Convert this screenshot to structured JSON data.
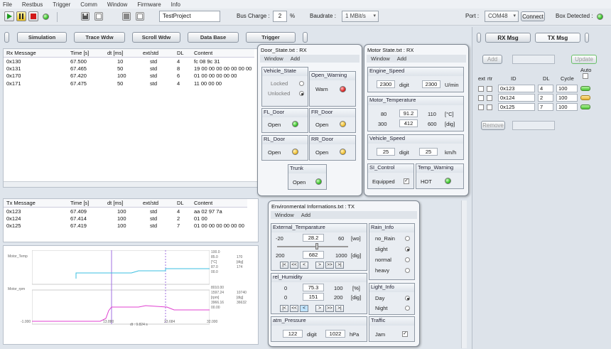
{
  "menu": [
    "File",
    "Restbus",
    "Trigger",
    "Comm",
    "Window",
    "Firmware",
    "Info"
  ],
  "toolbar": {
    "project_name": "TestProject",
    "bus_charge_label": "Bus Charge :",
    "bus_charge_value": "2",
    "bus_charge_unit": "%",
    "baudrate_label": "Baudrate :",
    "baudrate_value": "1 MBit/s",
    "port_label": "Port :",
    "port_value": "COM48",
    "connect_label": "Connect",
    "box_detected_label": "Box Detected :"
  },
  "tabs": [
    "Simulation",
    "Trace Wdw",
    "Scroll Wdw",
    "Data Base",
    "Trigger"
  ],
  "rx_table": {
    "headers": [
      "Rx Message",
      "Time [s]",
      "dt [ms]",
      "ext/std",
      "DL",
      "Content"
    ],
    "rows": [
      [
        "0x130",
        "67.500",
        "10",
        "std",
        "4",
        "fc 08 9c 31"
      ],
      [
        "0x131",
        "67.465",
        "50",
        "std",
        "8",
        "19 00 00 00 00 00 00 00"
      ],
      [
        "0x170",
        "67.420",
        "100",
        "std",
        "6",
        "01 00 00 00 00 00"
      ],
      [
        "0x171",
        "67.475",
        "50",
        "std",
        "4",
        "11 00 00 00"
      ]
    ]
  },
  "tx_table": {
    "headers": [
      "Tx Message",
      "Time [s]",
      "dt [ms]",
      "ext/std",
      "DL",
      "Content"
    ],
    "rows": [
      [
        "0x123",
        "67.409",
        "100",
        "std",
        "4",
        "aa 02 97 7a"
      ],
      [
        "0x124",
        "67.414",
        "100",
        "std",
        "2",
        "01 00"
      ],
      [
        "0x125",
        "67.419",
        "100",
        "std",
        "7",
        "01 00 00 00 00 00 00"
      ]
    ]
  },
  "graph": {
    "label_top": "Motor_Temp",
    "label_bottom": "Motor_rpm",
    "x_start": "-1.000",
    "x_cursor1": "13.880",
    "x_cursor2": "23.684",
    "x_end": "32.000",
    "dt_label": "dt : 9.824 s",
    "right_top": [
      "100.0",
      "85.0",
      "[°C]",
      "87.0",
      "00.0"
    ],
    "right_top2": [
      "170",
      "[dig]",
      "174"
    ],
    "right_bottom": [
      "8010.00",
      "1597.24",
      "[rpm]",
      "3966.16",
      "00.00"
    ],
    "right_bottom2": [
      "10740",
      "[dig]",
      "36632"
    ]
  },
  "door_window": {
    "title": "Door_State.txt : RX",
    "menu": [
      "Window",
      "Add"
    ],
    "vehicle_state": {
      "label": "Vehicle_State",
      "opt1": "Locked",
      "opt2": "Unlocked"
    },
    "open_warning": {
      "label": "Open_Warning",
      "value": "Warn"
    },
    "fl": {
      "label": "FL_Door",
      "value": "Open"
    },
    "fr": {
      "label": "FR_Door",
      "value": "Open"
    },
    "rl": {
      "label": "RL_Door",
      "value": "Open"
    },
    "rr": {
      "label": "RR_Door",
      "value": "Open"
    },
    "trunk": {
      "label": "Trunk",
      "value": "Open"
    }
  },
  "motor_window": {
    "title": "Motor State.txt : RX",
    "menu": [
      "Window",
      "Add"
    ],
    "engine_speed": {
      "label": "Engine_Speed",
      "v1": "2300",
      "u1": "digit",
      "v2": "2300",
      "u2": "U/min"
    },
    "motor_temp": {
      "label": "Motor_Temperature",
      "a1": "80",
      "a2": "91.2",
      "a3": "110",
      "au": "[°C]",
      "b1": "300",
      "b2": "412",
      "b3": "600",
      "bu": "[dig]"
    },
    "vehicle_speed": {
      "label": "Vehicle_Speed",
      "v1": "25",
      "u1": "digit",
      "v2": "25",
      "u2": "km/h"
    },
    "si_control": {
      "label": "SI_Control",
      "value": "Equipped"
    },
    "temp_warning": {
      "label": "Temp_Warning",
      "value": "HOT"
    }
  },
  "env_window": {
    "title": "Environmental Informations.txt : TX",
    "menu": [
      "Window",
      "Add"
    ],
    "ext_temp": {
      "label": "External_Temparature",
      "min": "-20",
      "val": "28.2",
      "max": "60",
      "unit": "[wo]",
      "dmin": "200",
      "dval": "682",
      "dmax": "1000",
      "dunit": "[dig]"
    },
    "humidity": {
      "label": "rel_Humidity",
      "min": "0",
      "val": "75.3",
      "max": "100",
      "unit": "[%]",
      "dmin": "0",
      "dval": "151",
      "dmax": "200",
      "dunit": "[dig]"
    },
    "pressure": {
      "label": "atm_Pressure",
      "v1": "122",
      "u1": "digit",
      "v2": "1022",
      "u2": "hPa"
    },
    "rain": {
      "label": "Rain_Info",
      "o1": "no_Rain",
      "o2": "slight",
      "o3": "normal",
      "o4": "heavy"
    },
    "light": {
      "label": "Light_Info",
      "o1": "Day",
      "o2": "Night"
    },
    "traffic": {
      "label": "Traffic",
      "value": "Jam"
    },
    "nav": [
      "|<",
      "<<",
      "<",
      ">",
      ">>",
      ">|"
    ]
  },
  "right_panel": {
    "tab_rx": "RX Msg",
    "tab_tx": "TX Msg",
    "add": "Add",
    "update": "Update",
    "auto": "Auto",
    "headers": [
      "ext",
      "rtr",
      "ID",
      "DL",
      "Cycle"
    ],
    "rows": [
      {
        "id": "0x123",
        "dl": "4",
        "cycle": "100",
        "led": "green"
      },
      {
        "id": "0x124",
        "dl": "2",
        "cycle": "100",
        "led": "yellow"
      },
      {
        "id": "0x125",
        "dl": "7",
        "cycle": "100",
        "led": "green"
      }
    ],
    "remove": "Remove"
  }
}
